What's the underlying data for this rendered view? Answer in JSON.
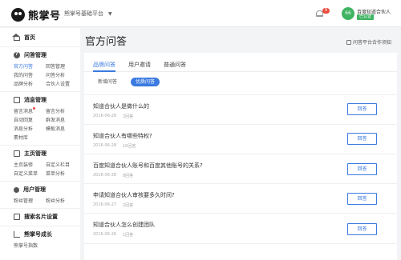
{
  "header": {
    "logo_text": "熊掌号",
    "platform": "熊掌号基础平台",
    "notification_count": "9",
    "avatar_text": "66",
    "user_name": "百度知道合伙人",
    "user_tag": "已认证"
  },
  "sidebar": {
    "home": "首页",
    "qa_section": "问答管理",
    "qa_items": [
      "官方问答",
      "回答管理",
      "我的问答",
      "问答分析",
      "品牌分析",
      "合伙人设置"
    ],
    "msg_section": "消息管理",
    "msg_items": [
      "留言消息",
      "留言分析",
      "自动回复",
      "群发消息",
      "消息分析",
      "模板消息",
      "素材库"
    ],
    "page_section": "主页管理",
    "page_items": [
      "主页装修",
      "自定义栏目",
      "自定义菜单",
      "菜单分析"
    ],
    "user_section": "用户管理",
    "user_items": [
      "粉丝管理",
      "粉丝分析"
    ],
    "search_section": "搜索名片设置",
    "grow_section": "熊掌号成长",
    "grow_items": [
      "熊掌号指数"
    ]
  },
  "main": {
    "title": "官方问答",
    "help_link": "问答平台合作须知",
    "tabs": [
      "品牌问答",
      "用户邀请",
      "普通问答"
    ],
    "subtabs": [
      "新增问答",
      "优质问答"
    ],
    "questions": [
      {
        "title": "知道合伙人是做什么的",
        "date": "2016-06-28",
        "count": "2回答",
        "action": "回答"
      },
      {
        "title": "知道合伙人有哪些特权?",
        "date": "2016-06-28",
        "count": "10回答",
        "action": "回答"
      },
      {
        "title": "百度知道合伙人账号和百度其他账号的关系?",
        "date": "2016-06-28",
        "count": "8回答",
        "action": "回答"
      },
      {
        "title": "申请知道合伙人审核要多久时间?",
        "date": "2016-06-27",
        "count": "2回答",
        "action": "回答"
      },
      {
        "title": "知道合伙人怎么创建团队",
        "date": "2016-06-26",
        "count": "1回答",
        "action": "回答"
      }
    ]
  },
  "colors": {
    "accent": "#3b7ae0",
    "badge": "#e94b3c",
    "brand_green": "#3fb463"
  }
}
